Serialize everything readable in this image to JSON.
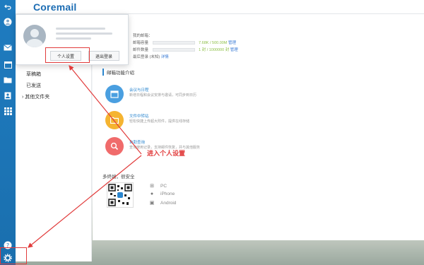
{
  "app": {
    "brand": "Coremail"
  },
  "rail": {
    "icons": [
      "back-icon",
      "user-avatar-icon",
      "mail-icon",
      "calendar-icon",
      "folder-icon",
      "contacts-icon",
      "apps-grid-icon",
      "help-icon",
      "settings-gear-icon"
    ]
  },
  "folders": [
    "草稿箱",
    "已发送",
    "其他文件夹"
  ],
  "folder_expand_glyph": "›",
  "account_info": {
    "mailbox_label": "我的邮箱：",
    "mailbox_value": "",
    "capacity_label": "邮箱容量",
    "capacity_value": "7.68K / 500.00M",
    "capacity_link": "管理",
    "files_label": "邮件数量",
    "files_value": "1 封 / 1000000 封",
    "files_link": "管理",
    "login_label": "最后登录",
    "login_value": "(未知)",
    "login_link": "详情"
  },
  "features": {
    "section_title": "邮箱功能介绍",
    "items": [
      {
        "icon": "calendar-icon",
        "color": "#4a9fe0",
        "title": "会议与日程",
        "desc": "新增日程和会议安排与邀请，可同步到日历"
      },
      {
        "icon": "folder-icon",
        "color": "#f5b431",
        "title": "文件中转站",
        "desc": "轻松快捷上传超大附件，提供在线存储"
      },
      {
        "icon": "search-icon",
        "color": "#f06b6b",
        "title": "自助查询",
        "desc": "查询使用记录，支持邮件恢复，并与其他服务"
      }
    ]
  },
  "multi": {
    "title": "多终端，很安全",
    "platforms": [
      {
        "icon": "windows-icon",
        "glyph": "⊞",
        "label": "PC"
      },
      {
        "icon": "apple-icon",
        "glyph": "●",
        "label": "iPhone"
      },
      {
        "icon": "android-icon",
        "glyph": "▣",
        "label": "Android"
      }
    ]
  },
  "popup": {
    "settings_button": "个人设置",
    "logout_button": "退出登录"
  },
  "annotation": {
    "text": "进入个人设置",
    "color": "#e13b3b"
  }
}
